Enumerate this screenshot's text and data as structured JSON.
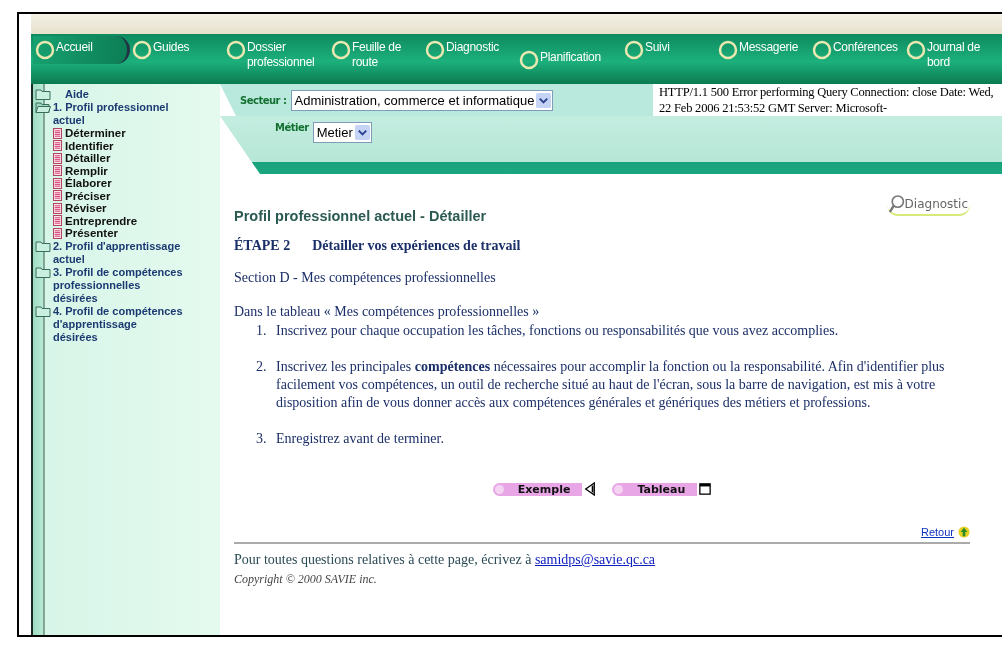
{
  "nav": [
    {
      "label": "Accueil",
      "selected": true
    },
    {
      "label": "Guides",
      "selected": false
    },
    {
      "label": "Dossier professionnel",
      "selected": false
    },
    {
      "label": "Feuille de route",
      "selected": false
    },
    {
      "label": "Diagnostic",
      "selected": false
    },
    {
      "label": "Planification",
      "selected": false
    },
    {
      "label": "Suivi",
      "selected": false
    },
    {
      "label": "Messagerie",
      "selected": false
    },
    {
      "label": "Conférences",
      "selected": false
    },
    {
      "label": "Journal de bord",
      "selected": false
    }
  ],
  "sidebar": {
    "items": [
      {
        "label": "Aide",
        "kind": "folder",
        "expanded": false
      },
      {
        "label": "1. Profil professionnel actuel",
        "kind": "folder",
        "expanded": true,
        "children": [
          {
            "label": "Déterminer",
            "kind": "page"
          },
          {
            "label": "Identifier",
            "kind": "page"
          },
          {
            "label": "Détailler",
            "kind": "page"
          },
          {
            "label": "Remplir",
            "kind": "page"
          },
          {
            "label": "Élaborer",
            "kind": "page"
          },
          {
            "label": "Préciser",
            "kind": "page"
          },
          {
            "label": "Réviser",
            "kind": "page"
          },
          {
            "label": "Entreprendre",
            "kind": "page"
          },
          {
            "label": "Présenter",
            "kind": "page"
          }
        ]
      },
      {
        "label": "2. Profil d'apprentissage actuel",
        "kind": "folder",
        "expanded": false
      },
      {
        "label": "3. Profil de compétences professionnelles désirées",
        "kind": "folder",
        "expanded": false
      },
      {
        "label": "4. Profil de compétences d'apprentissage désirées",
        "kind": "folder",
        "expanded": false
      }
    ]
  },
  "filters": {
    "secteur": {
      "label": "Secteur :",
      "value": "Administration, commerce et informatique"
    },
    "metier": {
      "label": "Métier",
      "value": "Metier"
    }
  },
  "error_text": "HTTP/1.1 500 Error performing Query Connection: close Date: Wed, 22 Feb 2006 21:53:52 GMT Server: Microsoft-",
  "logo": "Diagnostic",
  "page_title": "Profil professionnel actuel - Détailler",
  "step": {
    "number": "ÉTAPE 2",
    "title": "Détailler vos expériences de travail"
  },
  "section": "Section D - Mes compétences professionnelles",
  "intro": "Dans le tableau « Mes compétences professionnelles »",
  "instruction_numbers": [
    "1.",
    "2.",
    "3."
  ],
  "instructions": [
    "Inscrivez pour chaque occupation les tâches, fonctions ou responsabilités que vous avez accomplies.",
    "Inscrivez les principales **compétences** nécessaires pour accomplir la fonction ou la responsabilité. Afin d'identifier plus facilement vos compétences, un outil de recherche situé au haut de l'écran, sous la barre de navigation, est mis à votre disposition afin de vous donner accès aux compétences générales et génériques des métiers et professions.",
    "Enregistrez avant de terminer."
  ],
  "buttons": [
    {
      "label": "Exemple",
      "kind": "back"
    },
    {
      "label": "Tableau",
      "kind": "window"
    }
  ],
  "retour": "Retour",
  "footer": {
    "text": "Pour toutes questions relatives à cette page, écrivez à ",
    "email": "samidps@savie.qc.ca",
    "copyright": "Copyright © 2000 SAVIE inc."
  }
}
